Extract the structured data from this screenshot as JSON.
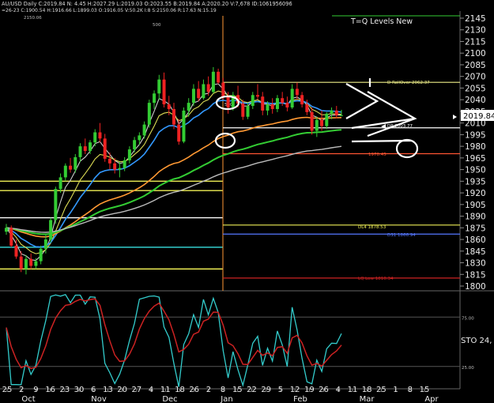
{
  "header": {
    "line1": "AU/USD Daily C:2019.84 N: 4.45 H:2027.29 L:2019.03 O:2023.55 B:2019.84 A:2020.20 V:7,678 ID:1061956096",
    "line2": "=26-23 C:1900.54 H:1916.66 L:1899.03 O:1916.05 V:50.2K I:8 S:2150.06 R:17.63 N:15.19"
  },
  "annotations": {
    "tq_title": "T=Q Levels New",
    "rollover": "D RollOver 2062.37",
    "dp": "DP 2003.77",
    "value_1970": "1970.45",
    "dl4": "DL4 1878.53",
    "ds1": "DS1 1866.94",
    "lq_low": "LQ Low 1810.34",
    "left_2150": "2150.06",
    "left_500_top": "500",
    "left_500_mid": "500",
    "last_price": "2019.84",
    "sto_label": "STO 24,"
  },
  "colors": {
    "background": "#000000",
    "up_candle": "#33cc33",
    "down_candle": "#ee2222",
    "ma_blue": "#3399ff",
    "ma_yellow": "#dddd55",
    "ma_white": "#cccccc",
    "ma_orange": "#ff9933",
    "ma_green": "#33cc33",
    "ma_lightgray": "#bbbbbb",
    "sto_cyan": "#33cccc",
    "sto_red": "#cc2222"
  },
  "chart_data": {
    "type": "candlestick",
    "title": "",
    "yaxis": {
      "ticks": [
        1800,
        1815,
        1830,
        1845,
        1860,
        1875,
        1890,
        1905,
        1920,
        1935,
        1950,
        1965,
        1980,
        1995,
        2010,
        2025,
        2040,
        2055,
        2070,
        2085,
        2100,
        2115,
        2130,
        2145
      ],
      "ylim": [
        1797,
        2150
      ]
    },
    "xaxis": {
      "day_labels": [
        "25",
        "2",
        "9",
        "16",
        "23",
        "30",
        "6",
        "13",
        "20",
        "27",
        "4",
        "11",
        "18",
        "26",
        "2",
        "8",
        "15",
        "22",
        "29",
        "5",
        "12",
        "19",
        "26",
        "4",
        "11",
        "18",
        "25",
        "1",
        "8",
        "15"
      ],
      "month_labels": [
        "Oct",
        "Nov",
        "Dec",
        "Jan",
        "Feb",
        "Mar",
        "Apr"
      ]
    },
    "candles": [
      [
        1870,
        1880,
        1866,
        1875
      ],
      [
        1875,
        1878,
        1850,
        1852
      ],
      [
        1852,
        1860,
        1835,
        1838
      ],
      [
        1838,
        1845,
        1818,
        1822
      ],
      [
        1822,
        1840,
        1815,
        1835
      ],
      [
        1835,
        1842,
        1822,
        1826
      ],
      [
        1826,
        1836,
        1822,
        1832
      ],
      [
        1832,
        1852,
        1828,
        1848
      ],
      [
        1848,
        1866,
        1842,
        1860
      ],
      [
        1860,
        1888,
        1856,
        1885
      ],
      [
        1885,
        1928,
        1880,
        1925
      ],
      [
        1925,
        1945,
        1920,
        1940
      ],
      [
        1940,
        1958,
        1935,
        1955
      ],
      [
        1955,
        1965,
        1946,
        1950
      ],
      [
        1950,
        1970,
        1946,
        1966
      ],
      [
        1966,
        1984,
        1960,
        1980
      ],
      [
        1980,
        1990,
        1970,
        1974
      ],
      [
        1974,
        1988,
        1970,
        1985
      ],
      [
        1985,
        2002,
        1980,
        1998
      ],
      [
        1998,
        2010,
        1985,
        1990
      ],
      [
        1990,
        1996,
        1960,
        1964
      ],
      [
        1964,
        1972,
        1950,
        1958
      ],
      [
        1958,
        1965,
        1945,
        1950
      ],
      [
        1950,
        1960,
        1940,
        1952
      ],
      [
        1952,
        1966,
        1948,
        1962
      ],
      [
        1962,
        1980,
        1958,
        1976
      ],
      [
        1976,
        1992,
        1972,
        1988
      ],
      [
        1988,
        1998,
        1982,
        1994
      ],
      [
        1994,
        2012,
        1990,
        2008
      ],
      [
        2008,
        2040,
        2004,
        2036
      ],
      [
        2036,
        2052,
        2028,
        2048
      ],
      [
        2048,
        2072,
        2040,
        2066
      ],
      [
        2066,
        2075,
        2030,
        2034
      ],
      [
        2034,
        2045,
        2020,
        2028
      ],
      [
        2028,
        2036,
        2002,
        2008
      ],
      [
        2008,
        2015,
        1982,
        1986
      ],
      [
        1986,
        2030,
        1984,
        2026
      ],
      [
        2026,
        2042,
        2018,
        2036
      ],
      [
        2036,
        2060,
        2032,
        2054
      ],
      [
        2054,
        2064,
        2038,
        2042
      ],
      [
        2042,
        2066,
        2040,
        2060
      ],
      [
        2060,
        2070,
        2045,
        2050
      ],
      [
        2050,
        2082,
        2048,
        2076
      ],
      [
        2076,
        2080,
        2060,
        2062
      ],
      [
        2062,
        2068,
        2040,
        2044
      ],
      [
        2044,
        2050,
        2022,
        2030
      ],
      [
        2030,
        2050,
        2026,
        2046
      ],
      [
        2046,
        2058,
        2030,
        2035
      ],
      [
        2035,
        2040,
        2014,
        2018
      ],
      [
        2018,
        2036,
        2015,
        2032
      ],
      [
        2032,
        2050,
        2028,
        2046
      ],
      [
        2046,
        2060,
        2040,
        2044
      ],
      [
        2044,
        2050,
        2020,
        2026
      ],
      [
        2026,
        2038,
        2020,
        2034
      ],
      [
        2034,
        2042,
        2022,
        2028
      ],
      [
        2028,
        2046,
        2024,
        2042
      ],
      [
        2042,
        2050,
        2032,
        2036
      ],
      [
        2036,
        2044,
        2025,
        2030
      ],
      [
        2030,
        2060,
        2028,
        2054
      ],
      [
        2054,
        2062,
        2040,
        2046
      ],
      [
        2046,
        2050,
        2030,
        2034
      ],
      [
        2034,
        2040,
        2020,
        2024
      ],
      [
        2024,
        2030,
        1995,
        2000
      ],
      [
        2000,
        2018,
        1992,
        2014
      ],
      [
        2014,
        2026,
        2000,
        2006
      ],
      [
        2006,
        2024,
        2002,
        2022
      ],
      [
        2022,
        2030,
        2015,
        2026
      ],
      [
        2026,
        2032,
        2016,
        2020
      ],
      [
        2020,
        2027,
        2019,
        2020
      ]
    ],
    "hlines": [
      {
        "name": "D RollOver",
        "value": 2062.37,
        "color": "#eeee88"
      },
      {
        "name": "DP",
        "value": 2003.77,
        "color": "#ffffff"
      },
      {
        "name": "1970.45",
        "value": 1970.45,
        "color": "#ff5533"
      },
      {
        "name": "DL4",
        "value": 1878.53,
        "color": "#eeee55"
      },
      {
        "name": "DS1",
        "value": 1866.94,
        "color": "#5577ff"
      },
      {
        "name": "LQ Low",
        "value": 1810.34,
        "color": "#cc2222"
      }
    ],
    "stochastic": {
      "ylim": [
        0,
        100
      ],
      "levels": [
        25,
        75
      ]
    }
  }
}
